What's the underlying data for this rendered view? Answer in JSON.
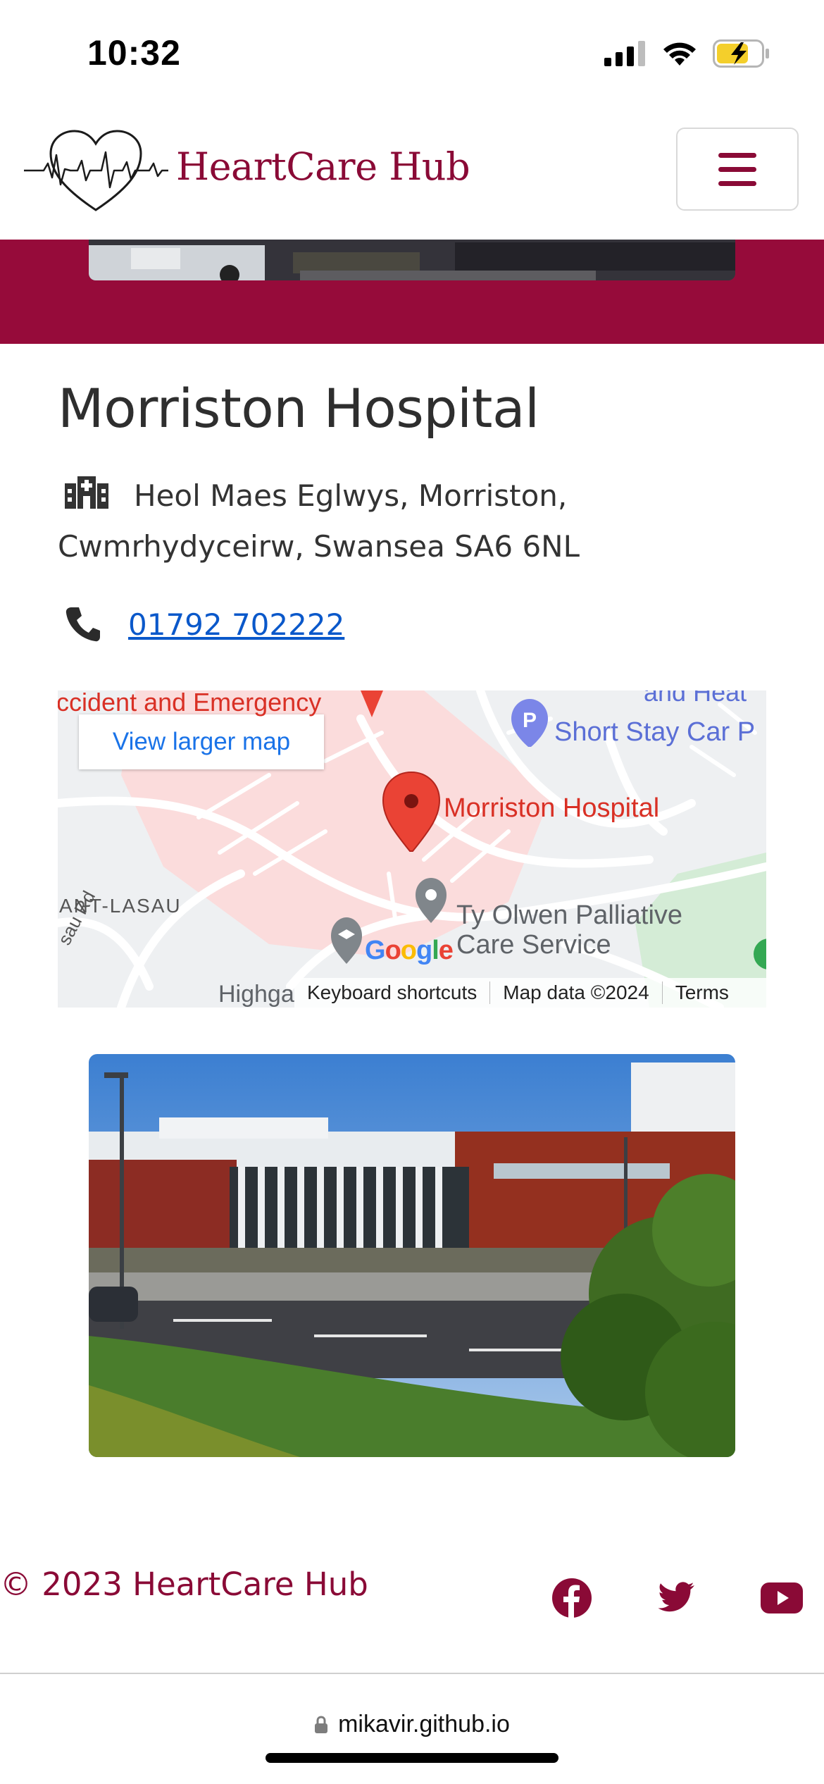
{
  "status_bar": {
    "time": "10:32"
  },
  "header": {
    "brand_name": "HeartCare Hub",
    "menu_icon": "hamburger-menu-icon"
  },
  "hospital": {
    "name": "Morriston Hospital",
    "address": "Heol Maes Eglwys, Morriston, Cwmrhydyceirw, Swansea SA6 6NL",
    "phone": "01792 702222",
    "address_icon": "hospital-icon",
    "phone_icon": "phone-icon"
  },
  "map": {
    "view_larger_label": "View larger map",
    "labels": {
      "accident_emergency": "ccident and Emergency",
      "top_right": "and Heat",
      "short_stay": "Short Stay Car P",
      "main_pin": "Morriston Hospital",
      "nant_lasau": "ANT-LASAU",
      "road": "sau Rd",
      "palliative_line1": "Ty Olwen Palliative",
      "palliative_line2": "Care Service",
      "bottom_road": "Highga"
    },
    "google_logo": "Google",
    "footer": {
      "shortcuts": "Keyboard shortcuts",
      "map_data": "Map data ©2024",
      "terms": "Terms"
    }
  },
  "footer": {
    "copyright": "© 2023 HeartCare Hub",
    "social": [
      "facebook-icon",
      "twitter-icon",
      "youtube-icon"
    ]
  },
  "browser": {
    "url": "mikavir.github.io"
  },
  "colors": {
    "brand": "#8a0a36",
    "hero_band": "#960b3a",
    "link": "#0a58ca",
    "map_link": "#1a73e8",
    "map_pin": "#ea4335"
  }
}
